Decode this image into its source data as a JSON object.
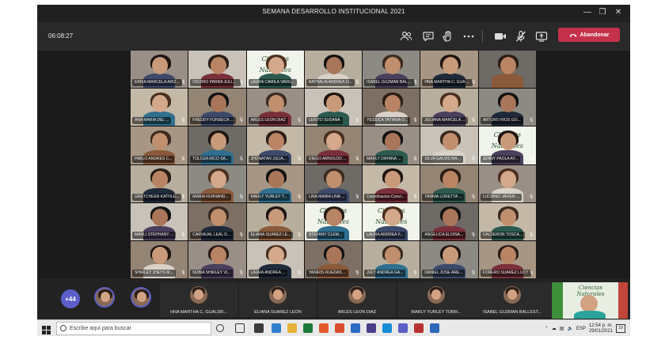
{
  "window": {
    "title": "SEMANA DESARROLLO INSTITUCIONAL 2021"
  },
  "toolbar": {
    "timer": "06:08:27",
    "leave_label": "Abandonar"
  },
  "grid": {
    "tiles": [
      {
        "name": "ERIKA MARCELA ARIZ..."
      },
      {
        "name": "OSORIO PARRA JULIO CE..."
      },
      {
        "name": "LAURA CAMILA VARG...",
        "banner": "Ciencias Naturales"
      },
      {
        "name": "NATHALIA ANDREA O..."
      },
      {
        "name": "ISABEL GUZMAN BALLEST..."
      },
      {
        "name": "HNA MARTHA C. GUALD..."
      },
      {
        "name": ""
      },
      {
        "name": "ANA MARIA DEL ..."
      },
      {
        "name": "FREDDY FONSECA ..."
      },
      {
        "name": "ARLES LEON DIAZ"
      },
      {
        "name": "LENITO SUSANA"
      },
      {
        "name": "YESSICA TATIANA O..."
      },
      {
        "name": "JULIANA MARCELA ..."
      },
      {
        "name": "ARTURO RIOS GO..."
      },
      {
        "name": "PABLO ANDRES C..."
      },
      {
        "name": "TOLOZA RICO SA..."
      },
      {
        "name": "JHONATAN JULIA..."
      },
      {
        "name": "DIEGO ARNOLDO ..."
      },
      {
        "name": "MARLY DAYANA ..."
      },
      {
        "name": "SILVA GALVIS MA..."
      },
      {
        "name": "JENNY PAOLA AY...",
        "banner": "Ciencias Naturales"
      },
      {
        "name": "GRETCHEEN KATHLE..."
      },
      {
        "name": "MARIA FERNAND..."
      },
      {
        "name": "MARLY YURLEY T..."
      },
      {
        "name": "LINA MARIA LINA ..."
      },
      {
        "name": "Coordinacion Convi..."
      },
      {
        "name": "TANNIA LORETTA ..."
      },
      {
        "name": "LUCIANO JAVIER ..."
      },
      {
        "name": "MARLI STEPHANY ..."
      },
      {
        "name": "CARVAJAL LEAL D..."
      },
      {
        "name": "ELIANA SUAREZ LE..."
      },
      {
        "name": "STEFANY CLEM...",
        "banner": "Ciencias Naturales"
      },
      {
        "name": "LAURA ANDREA F...",
        "banner": "Ciencias Naturales"
      },
      {
        "name": "ANGELICA ELOISA..."
      },
      {
        "name": "CALDERON TOSCA..."
      },
      {
        "name": "SHIRLEY JHEYS M..."
      },
      {
        "name": "NUBIA SHIRLEY VI..."
      },
      {
        "name": "LAURA ANDREA ..."
      },
      {
        "name": "YANIRIS RUEDAS ..."
      },
      {
        "name": "JULY ANDREA GA..."
      },
      {
        "name": "DANIEL JOSE ARE..."
      },
      {
        "name": "FORERO SUAREZ LUCY"
      }
    ]
  },
  "strip": {
    "more_count": "+44",
    "people": [
      {
        "name": "HNA MARTHA C. GUALDR..."
      },
      {
        "name": "ELIANA SUAREZ LEON"
      },
      {
        "name": "ARLES LEON DIAZ"
      },
      {
        "name": "MARLY YURLEY TORR..."
      },
      {
        "name": "ISABEL GUZMAN BALLEST..."
      }
    ],
    "self_banner": "Ciencias Naturales"
  },
  "taskbar": {
    "search_placeholder": "Escribe aquí para buscar",
    "language": "ESP",
    "time": "12:54 p. m.",
    "date": "29/01/2021",
    "notification_count": "19"
  },
  "colors": {
    "leave": "#c4314b",
    "accent": "#5b5fc7"
  }
}
